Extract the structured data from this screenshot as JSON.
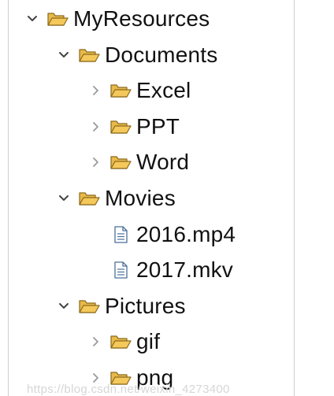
{
  "tree": {
    "nodes": [
      {
        "id": "myresources",
        "label": "MyResources",
        "kind": "folder",
        "state": "expanded",
        "depth": 0,
        "icon": "folder-open-icon"
      },
      {
        "id": "documents",
        "label": "Documents",
        "kind": "folder",
        "state": "expanded",
        "depth": 1,
        "icon": "folder-open-icon"
      },
      {
        "id": "excel",
        "label": "Excel",
        "kind": "folder",
        "state": "collapsed",
        "depth": 2,
        "icon": "folder-open-icon"
      },
      {
        "id": "ppt",
        "label": "PPT",
        "kind": "folder",
        "state": "collapsed",
        "depth": 2,
        "icon": "folder-open-icon"
      },
      {
        "id": "word",
        "label": "Word",
        "kind": "folder",
        "state": "collapsed",
        "depth": 2,
        "icon": "folder-open-icon"
      },
      {
        "id": "movies",
        "label": "Movies",
        "kind": "folder",
        "state": "expanded",
        "depth": 1,
        "icon": "folder-open-icon"
      },
      {
        "id": "file-2016-mp4",
        "label": "2016.mp4",
        "kind": "file",
        "state": "leaf",
        "depth": 2,
        "icon": "file-icon"
      },
      {
        "id": "file-2017-mkv",
        "label": "2017.mkv",
        "kind": "file",
        "state": "leaf",
        "depth": 2,
        "icon": "file-icon"
      },
      {
        "id": "pictures",
        "label": "Pictures",
        "kind": "folder",
        "state": "expanded",
        "depth": 1,
        "icon": "folder-open-icon"
      },
      {
        "id": "gif",
        "label": "gif",
        "kind": "folder",
        "state": "collapsed",
        "depth": 2,
        "icon": "folder-open-icon"
      },
      {
        "id": "png",
        "label": "png",
        "kind": "folder",
        "state": "collapsed",
        "depth": 2,
        "icon": "folder-open-icon"
      }
    ]
  },
  "watermark": {
    "text": "https://blog.csdn.net/weixin_4273400"
  },
  "colors": {
    "folder_fill": "#f5c85b",
    "folder_stroke": "#8a6a1c",
    "file_fill": "#ffffff",
    "file_stroke": "#4a6f9a",
    "toggle_expanded": "#444444",
    "toggle_collapsed": "#9a9a9a",
    "label": "#111111"
  }
}
